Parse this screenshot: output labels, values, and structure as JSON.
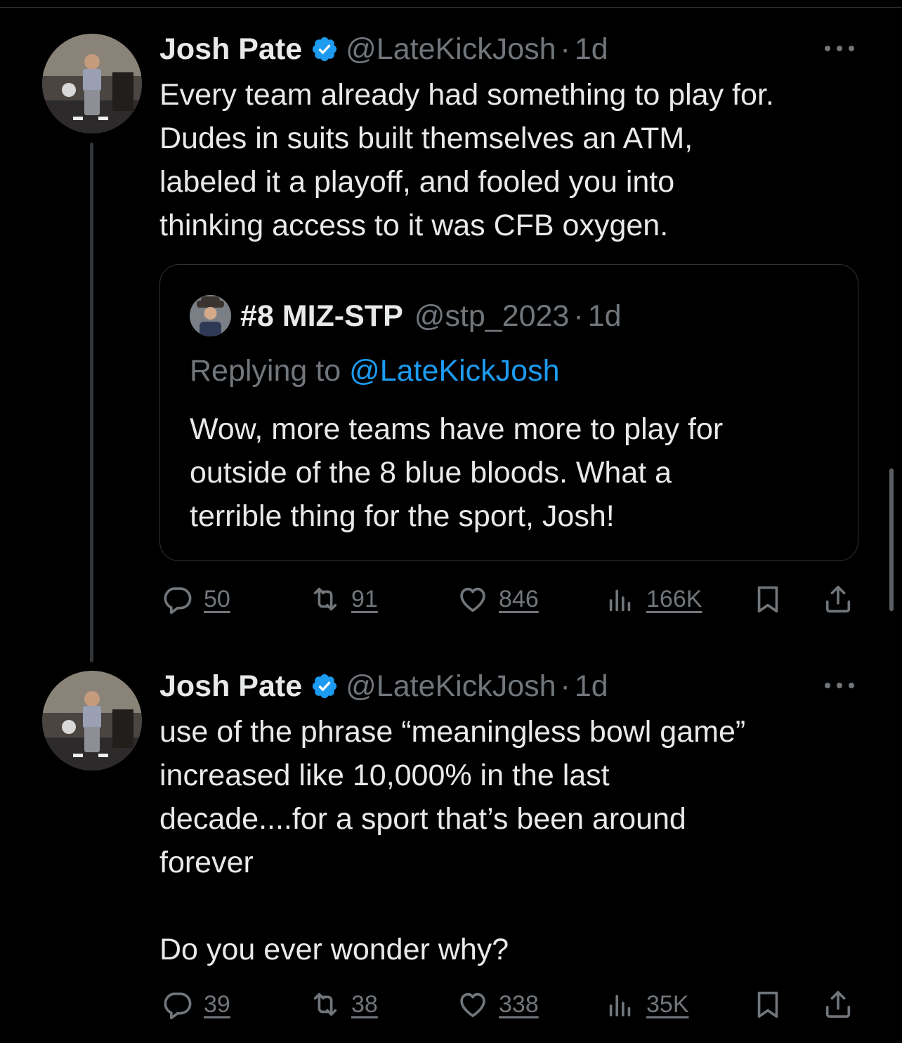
{
  "tweets": [
    {
      "display_name": "Josh Pate",
      "handle": "@LateKickJosh",
      "separator": "·",
      "time": "1d",
      "text": "Every team already had something to play for.\nDudes in suits built themselves an ATM,\nlabeled it a playoff, and fooled you into\nthinking access to it was CFB oxygen.",
      "quote": {
        "display_name": "#8 MIZ-STP",
        "handle": "@stp_2023",
        "separator": "·",
        "time": "1d",
        "replying_prefix": "Replying to ",
        "replying_handle": "@LateKickJosh",
        "text": "Wow, more teams have more to play for\noutside of the 8 blue bloods. What a\nterrible thing for the sport, Josh!"
      },
      "actions": {
        "replies": "50",
        "reposts": "91",
        "likes": "846",
        "views": "166K"
      }
    },
    {
      "display_name": "Josh Pate",
      "handle": "@LateKickJosh",
      "separator": "·",
      "time": "1d",
      "text": "use of the phrase “meaningless bowl game”\nincreased like 10,000% in the last\ndecade....for a sport that’s been around\nforever\n\nDo you ever wonder why?",
      "actions": {
        "replies": "39",
        "reposts": "38",
        "likes": "338",
        "views": "35K"
      }
    }
  ],
  "icons": {
    "verified": "verified-badge-icon",
    "more": "more-options-icon",
    "reply": "reply-icon",
    "repost": "repost-icon",
    "like": "like-icon",
    "views": "views-icon",
    "bookmark": "bookmark-icon",
    "share": "share-icon"
  },
  "colors": {
    "background": "#000000",
    "text": "#e7e9ea",
    "muted": "#71767b",
    "accent": "#1d9bf0",
    "border": "#2f3336"
  }
}
